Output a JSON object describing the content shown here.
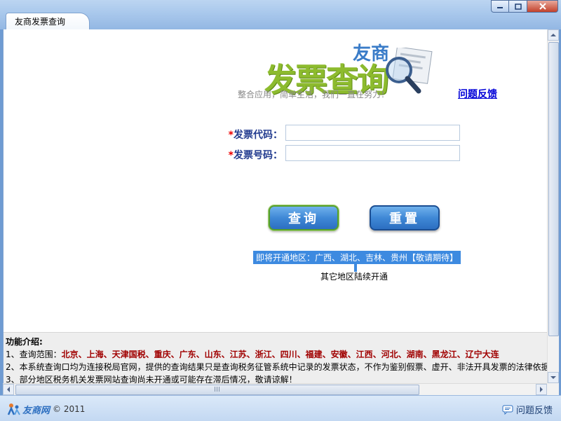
{
  "window": {
    "tab_title": "友商发票查询",
    "controls": [
      "minimize",
      "maximize",
      "close"
    ]
  },
  "logo": {
    "brand": "友商",
    "title": "发票查询",
    "icon": "magnifier-document-icon"
  },
  "slogan": "整合应用，简单生活，我们一直在努力！",
  "feedback_link": "问题反馈",
  "form": {
    "invoice_code_label": "发票代码：",
    "invoice_code_value": "",
    "invoice_number_label": "发票号码：",
    "invoice_number_value": "",
    "required_mark": "*",
    "query_button": "查询",
    "reset_button": "重置"
  },
  "regions_notice": "即将开通地区：广西、湖北、吉林、贵州【敬请期待】",
  "others_notice": "其它地区陆续开通",
  "intro": {
    "heading": "功能介绍:",
    "line1_prefix": "1、查询范围：",
    "line1_regions": "北京、上海、天津国税、重庆、广东、山东、江苏、浙江、四川、福建、安徽、江西、河北、湖南、黑龙江、辽宁大连",
    "line2": "2、本系统查询口均为连接税局官网，提供的查询结果只是查询税务征管系统中记录的发票状态，不作为鉴别假票、虚开、非法开具发票的法律依据",
    "line3": "3、部分地区税务机关发票网站查询尚未开通或可能存在滞后情况，敬请谅解！"
  },
  "statusbar": {
    "brand": "友商网",
    "copyright": "© 2011",
    "feedback": "问题反馈"
  },
  "colors": {
    "title_green": "#8dbb2e",
    "brand_blue": "#3a7cc8",
    "label_blue": "#223b8f",
    "region_red": "#a00000",
    "button_blue": "#3f88d6",
    "highlight_blue": "#3d8ae0"
  }
}
